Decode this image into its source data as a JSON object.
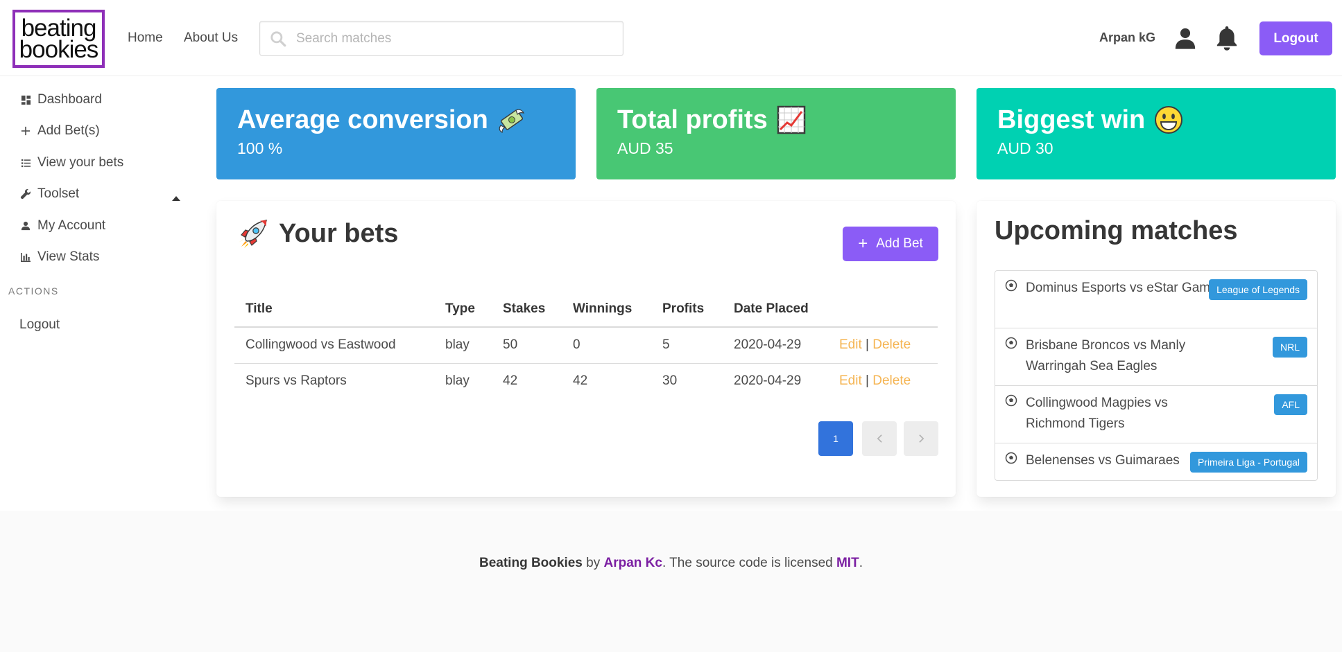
{
  "brand": {
    "line1": "beating",
    "line2": "bookies",
    "color": "#8e2fb8"
  },
  "nav": {
    "home": "Home",
    "about": "About Us"
  },
  "search": {
    "placeholder": "Search matches",
    "value": ""
  },
  "user": {
    "name": "Arpan kG",
    "logout": "Logout"
  },
  "sidebar": {
    "items": [
      {
        "label": "Dashboard",
        "icon": "dashboard-icon"
      },
      {
        "label": "Add Bet(s)",
        "icon": "plus-icon"
      },
      {
        "label": "View your bets",
        "icon": "list-icon"
      },
      {
        "label": "Toolset",
        "icon": "wrench-icon",
        "expanded": true
      },
      {
        "label": "My Account",
        "icon": "user-icon"
      },
      {
        "label": "View Stats",
        "icon": "bar-chart-icon"
      }
    ],
    "section_label": "ACTIONS",
    "actions": [
      {
        "label": "Logout"
      }
    ]
  },
  "stats": [
    {
      "title": "Average conversion",
      "value": "100 %",
      "emoji": "money-with-wings-icon",
      "color": "#3298dc"
    },
    {
      "title": "Total profits",
      "value": "AUD 35",
      "emoji": "chart-increasing-icon",
      "color": "#48c774"
    },
    {
      "title": "Biggest win",
      "value": "AUD 30",
      "emoji": "smiley-icon",
      "color": "#00d1b2"
    }
  ],
  "bets": {
    "title": "Your bets",
    "add_button": "Add Bet",
    "columns": [
      "Title",
      "Type",
      "Stakes",
      "Winnings",
      "Profits",
      "Date Placed"
    ],
    "rows": [
      {
        "title": "Collingwood vs Eastwood",
        "type": "blay",
        "stakes": "50",
        "winnings": "0",
        "profits": "5",
        "date": "2020-04-29"
      },
      {
        "title": "Spurs vs Raptors",
        "type": "blay",
        "stakes": "42",
        "winnings": "42",
        "profits": "30",
        "date": "2020-04-29"
      }
    ],
    "edit_label": "Edit",
    "delete_label": "Delete",
    "separator": "|",
    "pagination": {
      "current": "1",
      "prev": "‹",
      "next": "›"
    }
  },
  "upcoming": {
    "title": "Upcoming matches",
    "matches": [
      {
        "name": "Dominus Esports vs eStar Gaming",
        "tag": "League of Legends"
      },
      {
        "name": "Brisbane Broncos vs Manly Warringah Sea Eagles",
        "tag": "NRL"
      },
      {
        "name": "Collingwood Magpies vs Richmond Tigers",
        "tag": "AFL"
      },
      {
        "name": "Belenenses vs Guimaraes",
        "tag": "Primeira Liga - Portugal"
      }
    ]
  },
  "footer": {
    "project": "Beating Bookies",
    "by": " by ",
    "author": "Arpan Kc",
    "mid": ". The source code is licensed ",
    "license": "MIT",
    "end": "."
  }
}
